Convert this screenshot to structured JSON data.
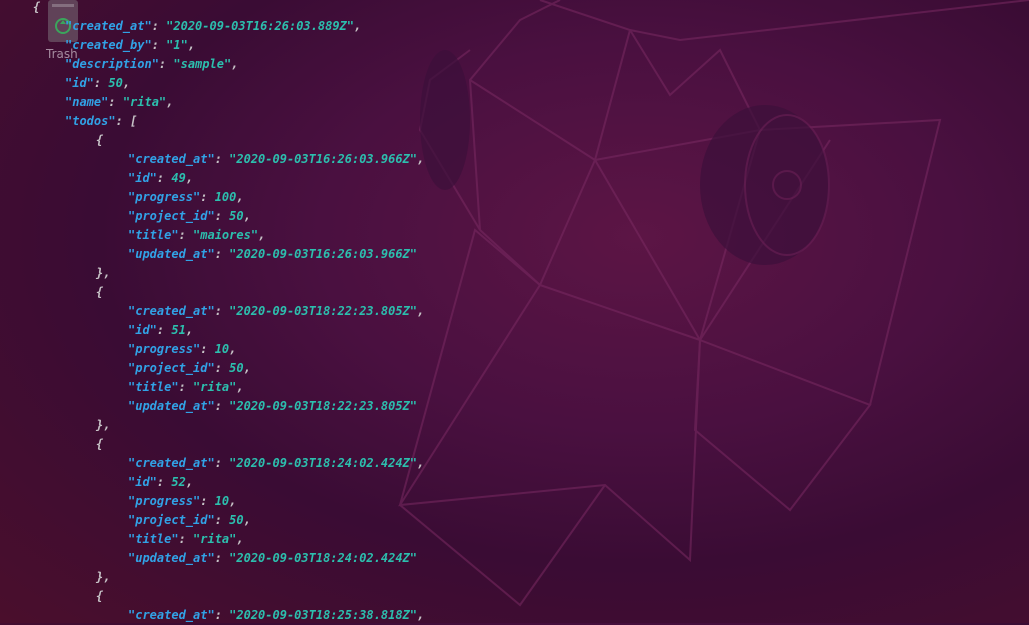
{
  "desktop": {
    "trash_label": "Trash"
  },
  "json_view": {
    "lines": [
      {
        "indent": 0,
        "text": "{"
      },
      {
        "indent": 1,
        "key": "\"created_at\"",
        "value": "\"2020-09-03T16:26:03.889Z\"",
        "type": "str",
        "tail": ","
      },
      {
        "indent": 1,
        "key": "\"created_by\"",
        "value": "\"1\"",
        "type": "str",
        "tail": ","
      },
      {
        "indent": 1,
        "key": "\"description\"",
        "value": "\"sample\"",
        "type": "str",
        "tail": ","
      },
      {
        "indent": 1,
        "key": "\"id\"",
        "value": "50",
        "type": "num",
        "tail": ","
      },
      {
        "indent": 1,
        "key": "\"name\"",
        "value": "\"rita\"",
        "type": "str",
        "tail": ","
      },
      {
        "indent": 1,
        "key": "\"todos\"",
        "value": "[",
        "type": "punct",
        "tail": ""
      },
      {
        "indent": 2,
        "text": "{"
      },
      {
        "indent": 3,
        "key": "\"created_at\"",
        "value": "\"2020-09-03T16:26:03.966Z\"",
        "type": "str",
        "tail": ","
      },
      {
        "indent": 3,
        "key": "\"id\"",
        "value": "49",
        "type": "num",
        "tail": ","
      },
      {
        "indent": 3,
        "key": "\"progress\"",
        "value": "100",
        "type": "num",
        "tail": ","
      },
      {
        "indent": 3,
        "key": "\"project_id\"",
        "value": "50",
        "type": "num",
        "tail": ","
      },
      {
        "indent": 3,
        "key": "\"title\"",
        "value": "\"maiores\"",
        "type": "str",
        "tail": ","
      },
      {
        "indent": 3,
        "key": "\"updated_at\"",
        "value": "\"2020-09-03T16:26:03.966Z\"",
        "type": "str",
        "tail": ""
      },
      {
        "indent": 2,
        "text": "},"
      },
      {
        "indent": 2,
        "text": "{"
      },
      {
        "indent": 3,
        "key": "\"created_at\"",
        "value": "\"2020-09-03T18:22:23.805Z\"",
        "type": "str",
        "tail": ","
      },
      {
        "indent": 3,
        "key": "\"id\"",
        "value": "51",
        "type": "num",
        "tail": ","
      },
      {
        "indent": 3,
        "key": "\"progress\"",
        "value": "10",
        "type": "num",
        "tail": ","
      },
      {
        "indent": 3,
        "key": "\"project_id\"",
        "value": "50",
        "type": "num",
        "tail": ","
      },
      {
        "indent": 3,
        "key": "\"title\"",
        "value": "\"rita\"",
        "type": "str",
        "tail": ","
      },
      {
        "indent": 3,
        "key": "\"updated_at\"",
        "value": "\"2020-09-03T18:22:23.805Z\"",
        "type": "str",
        "tail": ""
      },
      {
        "indent": 2,
        "text": "},"
      },
      {
        "indent": 2,
        "text": "{"
      },
      {
        "indent": 3,
        "key": "\"created_at\"",
        "value": "\"2020-09-03T18:24:02.424Z\"",
        "type": "str",
        "tail": ","
      },
      {
        "indent": 3,
        "key": "\"id\"",
        "value": "52",
        "type": "num",
        "tail": ","
      },
      {
        "indent": 3,
        "key": "\"progress\"",
        "value": "10",
        "type": "num",
        "tail": ","
      },
      {
        "indent": 3,
        "key": "\"project_id\"",
        "value": "50",
        "type": "num",
        "tail": ","
      },
      {
        "indent": 3,
        "key": "\"title\"",
        "value": "\"rita\"",
        "type": "str",
        "tail": ","
      },
      {
        "indent": 3,
        "key": "\"updated_at\"",
        "value": "\"2020-09-03T18:24:02.424Z\"",
        "type": "str",
        "tail": ""
      },
      {
        "indent": 2,
        "text": "},"
      },
      {
        "indent": 2,
        "text": "{"
      },
      {
        "indent": 3,
        "key": "\"created_at\"",
        "value": "\"2020-09-03T18:25:38.818Z\"",
        "type": "str",
        "tail": ","
      }
    ]
  },
  "colors": {
    "background": "#4a1040",
    "json_key": "#31a2e6",
    "json_value": "#2cbfae",
    "json_punct": "#c6c2c6"
  }
}
